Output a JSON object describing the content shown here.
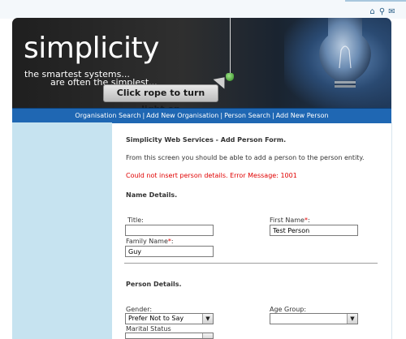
{
  "toolbar": {
    "home_icon": "home-icon",
    "search_icon": "search-icon",
    "mail_icon": "mail-icon"
  },
  "banner": {
    "logo": "simplicity",
    "tagline_1": "the smartest systems...",
    "tagline_2": "are often the simplest...",
    "callout": "Click rope to turn light on"
  },
  "nav": {
    "items": [
      "Organisation Search",
      "Add New Organisation",
      "Person Search",
      "Add New Person"
    ],
    "separator": "|"
  },
  "content": {
    "title": "Simplicity Web Services - Add Person Form.",
    "intro": "From this screen you should be able to add a person to the person entity.",
    "error": "Could not insert person details. Error Message: 1001",
    "name_section": "Name Details.",
    "person_section": "Person Details."
  },
  "fields": {
    "title_label": "Title:",
    "title_value": "",
    "first_name_label": "First Name",
    "first_name_value": "Test Person",
    "family_name_label": "Family Name",
    "family_name_value": "Guy",
    "required_mark": "*",
    "colon": ":",
    "gender_label": "Gender:",
    "gender_value": "Prefer Not to Say",
    "age_group_label": "Age Group:",
    "age_group_value": "",
    "marital_status_label": "Marital Status",
    "marital_status_value": ""
  },
  "colors": {
    "nav_bg": "#1f67b3",
    "sidebar_bg": "#c6e3f0",
    "error": "#e00000"
  }
}
